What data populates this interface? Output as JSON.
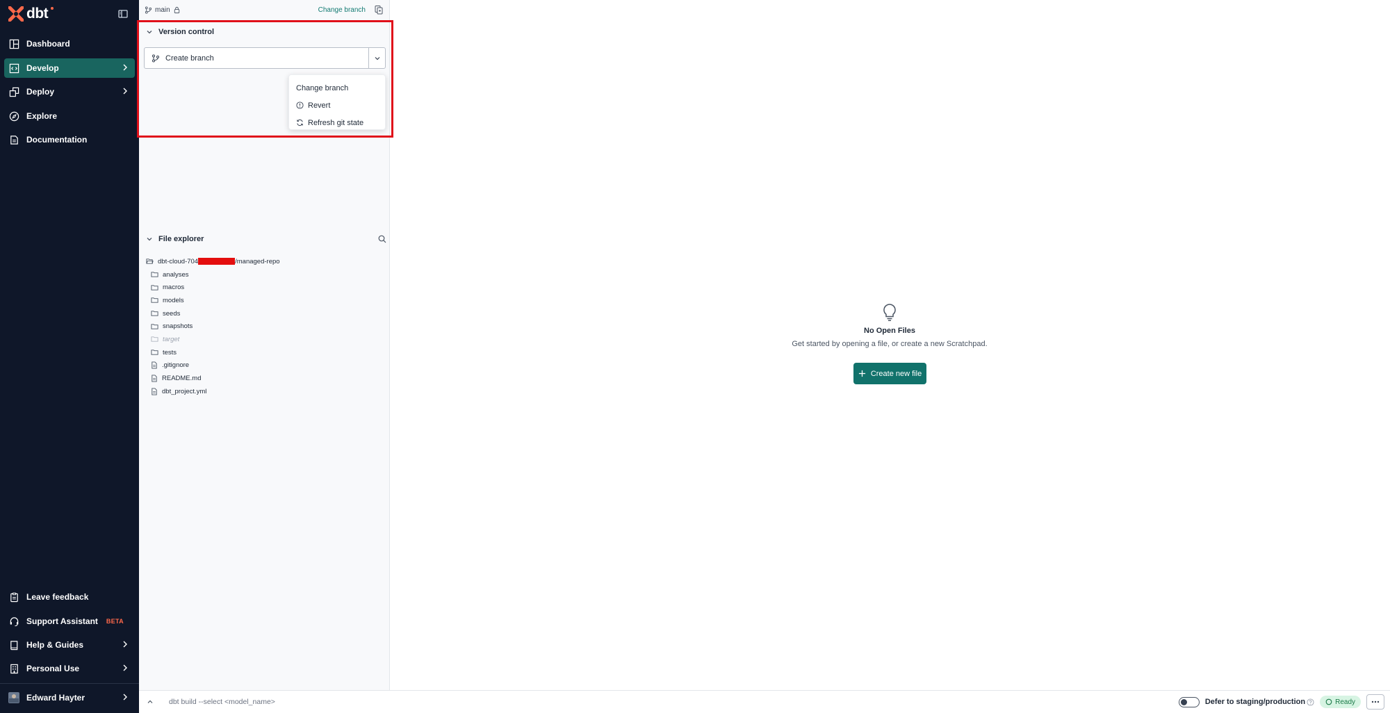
{
  "nav": {
    "logo_text": "dbt",
    "items": [
      {
        "label": "Dashboard",
        "icon": "dashboard-icon"
      },
      {
        "label": "Develop",
        "icon": "code-icon",
        "active": true
      },
      {
        "label": "Deploy",
        "icon": "deploy-icon"
      },
      {
        "label": "Explore",
        "icon": "compass-icon"
      },
      {
        "label": "Documentation",
        "icon": "docs-icon"
      }
    ],
    "bottom_items": [
      {
        "label": "Leave feedback",
        "icon": "clipboard-icon"
      },
      {
        "label": "Support Assistant",
        "badge": "BETA",
        "icon": "headset-icon"
      },
      {
        "label": "Help & Guides",
        "icon": "book-icon"
      },
      {
        "label": "Personal Use",
        "icon": "building-icon"
      }
    ],
    "user": {
      "name": "Edward Hayter"
    }
  },
  "panel": {
    "branch_name": "main",
    "change_branch_link": "Change branch",
    "version_control": {
      "title": "Version control",
      "create_branch_label": "Create branch",
      "menu": [
        {
          "label": "Change branch"
        },
        {
          "label": "Revert",
          "icon": "alert-circle-icon"
        },
        {
          "label": "Refresh git state",
          "icon": "refresh-icon"
        }
      ]
    },
    "file_explorer": {
      "title": "File explorer",
      "root_prefix": "dbt-cloud-704",
      "root_suffix": "/managed-repo",
      "items": [
        {
          "name": "analyses",
          "type": "folder"
        },
        {
          "name": "macros",
          "type": "folder"
        },
        {
          "name": "models",
          "type": "folder"
        },
        {
          "name": "seeds",
          "type": "folder"
        },
        {
          "name": "snapshots",
          "type": "folder"
        },
        {
          "name": "target",
          "type": "folder",
          "muted": true
        },
        {
          "name": "tests",
          "type": "folder"
        },
        {
          "name": ".gitignore",
          "type": "file"
        },
        {
          "name": "README.md",
          "type": "file"
        },
        {
          "name": "dbt_project.yml",
          "type": "file"
        }
      ]
    }
  },
  "main": {
    "empty_title": "No Open Files",
    "empty_subtitle": "Get started by opening a file, or create a new Scratchpad.",
    "create_button": "Create new file"
  },
  "bottombar": {
    "command_placeholder": "dbt build --select <model_name>",
    "defer_label": "Defer to staging/production",
    "status": "Ready"
  },
  "colors": {
    "nav_bg": "#0f1729",
    "accent": "#11726b",
    "brand": "#ff694a",
    "highlight": "#e0101a"
  }
}
